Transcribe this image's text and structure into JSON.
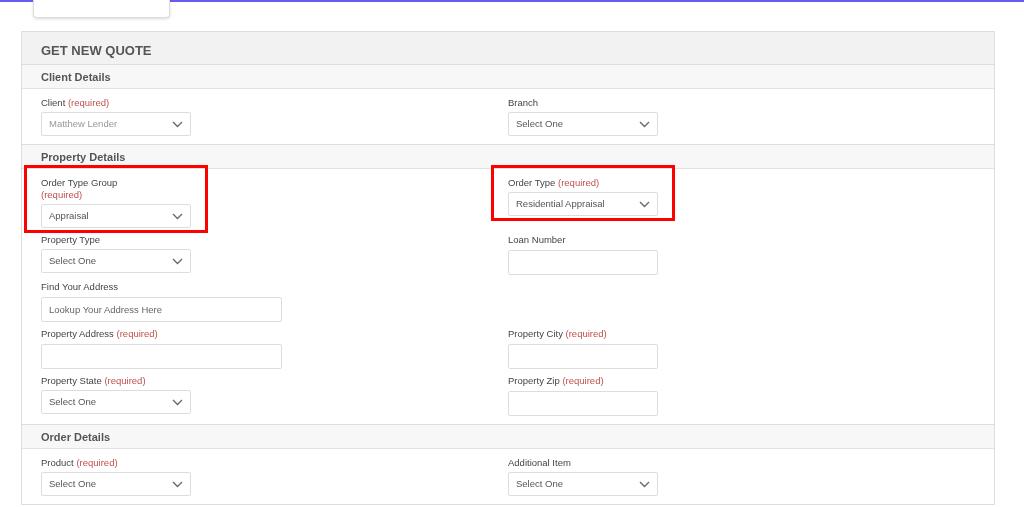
{
  "title": "GET NEW QUOTE",
  "sections": [
    {
      "title": "Client Details",
      "rows": [
        [
          {
            "label": "Client",
            "required_note": "(required)",
            "note_on_own_line": false,
            "kind": "select",
            "value": "Matthew Lender",
            "disabled": true,
            "highlighted": false
          },
          {
            "label": "Branch",
            "kind": "select",
            "value": "Select One",
            "disabled": false,
            "highlighted": false
          }
        ]
      ]
    },
    {
      "title": "Property Details",
      "rows": [
        [
          {
            "label": "Order Type Group",
            "required_note": "(required)",
            "note_on_own_line": true,
            "kind": "select",
            "value": "Appraisal",
            "disabled": false,
            "highlighted": true
          },
          {
            "label": "Order Type",
            "required_note": "(required)",
            "note_on_own_line": false,
            "kind": "select",
            "value": "Residential Appraisal",
            "disabled": false,
            "highlighted": true
          }
        ],
        [
          {
            "label": "Property Type",
            "kind": "select",
            "value": "Select One",
            "disabled": false,
            "highlighted": false
          },
          {
            "label": "Loan Number",
            "kind": "input",
            "highlighted": false
          }
        ],
        [
          {
            "label": "Find Your Address",
            "kind": "input",
            "wide": true,
            "placeholder": "Lookup Your Address Here",
            "highlighted": false
          }
        ],
        [
          {
            "label": "Property Address",
            "required_note": "(required)",
            "note_on_own_line": false,
            "kind": "input",
            "wide": true,
            "highlighted": false
          },
          {
            "label": "Property City",
            "required_note": "(required)",
            "note_on_own_line": false,
            "kind": "input",
            "highlighted": false
          }
        ],
        [
          {
            "label": "Property State",
            "required_note": "(required)",
            "note_on_own_line": false,
            "kind": "select",
            "value": "Select One",
            "disabled": false,
            "highlighted": false
          },
          {
            "label": "Property Zip",
            "required_note": "(required)",
            "note_on_own_line": false,
            "kind": "input",
            "highlighted": false
          }
        ]
      ]
    },
    {
      "title": "Order Details",
      "rows": [
        [
          {
            "label": "Product",
            "required_note": "(required)",
            "note_on_own_line": false,
            "kind": "select",
            "value": "Select One",
            "disabled": false,
            "highlighted": false
          },
          {
            "label": "Additional Item",
            "kind": "select",
            "value": "Select One",
            "disabled": false,
            "highlighted": false
          }
        ]
      ]
    }
  ]
}
